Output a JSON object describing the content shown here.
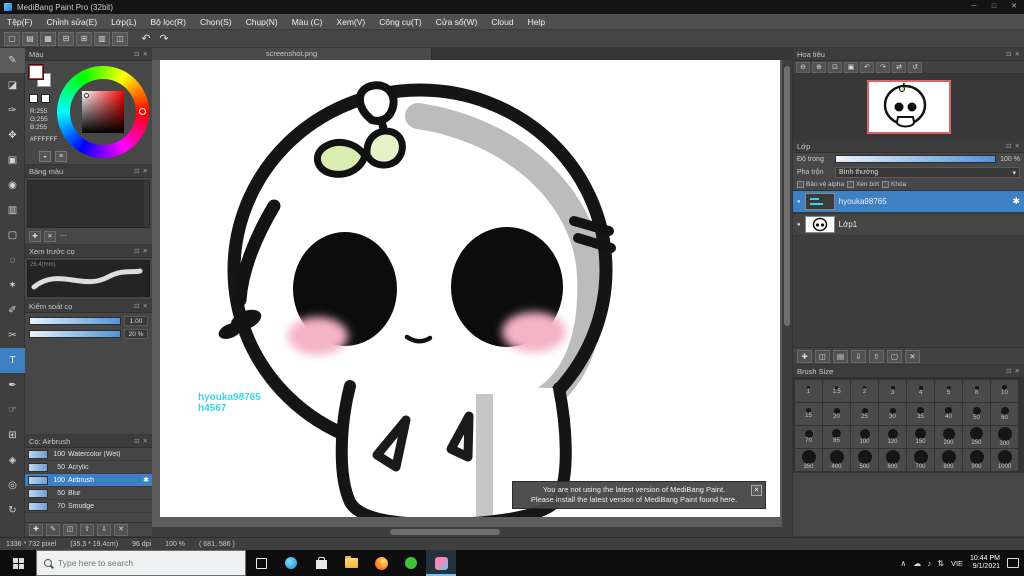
{
  "titlebar": {
    "title": "MediBang Paint Pro (32bit)",
    "minimize": "─",
    "maximize": "□",
    "close": "✕"
  },
  "menubar": [
    "Tệp(F)",
    "Chỉnh sửa(E)",
    "Lớp(L)",
    "Bộ lọc(R)",
    "Chọn(S)",
    "Chụp(N)",
    "Màu (C)",
    "Xem(V)",
    "Công cụ(T)",
    "Cửa sổ(W)",
    "Cloud",
    "Help"
  ],
  "panel": {
    "float_icon": "⊡",
    "close_icon": "✕"
  },
  "toolbar": {
    "buttons": [
      {
        "name": "new-canvas-button",
        "glyph": "▢"
      },
      {
        "name": "open-file-button",
        "glyph": "▤"
      },
      {
        "name": "save-file-button",
        "glyph": "▦"
      },
      {
        "name": "export-button",
        "glyph": "⊟"
      },
      {
        "name": "grid-toggle-button",
        "glyph": "⊞"
      },
      {
        "name": "ruler-toggle-button",
        "glyph": "▥"
      },
      {
        "name": "material-panel-button",
        "glyph": "◫"
      }
    ],
    "undo": "↶",
    "redo": "↷"
  },
  "tools": [
    {
      "name": "brush-tool",
      "glyph": "✎",
      "hover": true
    },
    {
      "name": "eraser-tool",
      "glyph": "◪"
    },
    {
      "name": "pen-tool",
      "glyph": "✑"
    },
    {
      "name": "move-tool",
      "glyph": "✥"
    },
    {
      "name": "fill-tool",
      "glyph": "▣"
    },
    {
      "name": "bucket-tool",
      "glyph": "◉"
    },
    {
      "name": "gradient-tool",
      "glyph": "▥"
    },
    {
      "name": "select-tool",
      "glyph": "▢"
    },
    {
      "name": "lasso-tool",
      "glyph": "◌"
    },
    {
      "name": "magic-wand-tool",
      "glyph": "✶"
    },
    {
      "name": "select-pen-tool",
      "glyph": "✐"
    },
    {
      "name": "select-eraser-tool",
      "glyph": "✂"
    },
    {
      "name": "text-tool",
      "glyph": "T",
      "selected": true
    },
    {
      "name": "eyedropper-tool",
      "glyph": "✒"
    },
    {
      "name": "hand-tool",
      "glyph": "☞"
    },
    {
      "name": "divide-tool",
      "glyph": "⊞"
    },
    {
      "name": "operation-tool",
      "glyph": "◈"
    },
    {
      "name": "snap-tool",
      "glyph": "◎"
    },
    {
      "name": "rotate-canvas-tool",
      "glyph": "↻"
    }
  ],
  "color_panel": {
    "title": "Màu",
    "r": "R:255",
    "g": "G:255",
    "b": "B:255",
    "hex": "#FFFFFF",
    "mode_buttons": [
      {
        "name": "wheel-mode-button",
        "glyph": "◒"
      },
      {
        "name": "slider-mode-button",
        "glyph": "≡"
      }
    ]
  },
  "palette_panel": {
    "title": "Bảng màu",
    "footer_label": "---",
    "buttons": [
      {
        "name": "add-color-button",
        "glyph": "✚"
      },
      {
        "name": "delete-color-button",
        "glyph": "✕"
      }
    ]
  },
  "preview_panel": {
    "title": "Xem trước cọ",
    "size_label": "26.4(mm)"
  },
  "control_panel": {
    "title": "Kiểm soát cọ",
    "rows": [
      {
        "name": "brush-size-slider",
        "value": "1.00"
      },
      {
        "name": "brush-opacity-slider",
        "value": "20 %"
      }
    ]
  },
  "brush_panel": {
    "title": "Cọ: Airbrush",
    "gear": "✱",
    "items": [
      {
        "size": "100",
        "name": "Watercolor (Wet)"
      },
      {
        "size": "50",
        "name": "Acrylic"
      },
      {
        "size": "100",
        "name": "Airbrush",
        "selected": true
      },
      {
        "size": "50",
        "name": "Blur"
      },
      {
        "size": "70",
        "name": "Smudge"
      }
    ],
    "buttons": [
      {
        "name": "add-brush-button",
        "glyph": "✚"
      },
      {
        "name": "edit-brush-button",
        "glyph": "✎"
      },
      {
        "name": "duplicate-brush-button",
        "glyph": "◫"
      },
      {
        "name": "brush-up-button",
        "glyph": "⇧"
      },
      {
        "name": "brush-down-button",
        "glyph": "⇩"
      },
      {
        "name": "delete-brush-button",
        "glyph": "✕"
      }
    ]
  },
  "navigator_panel": {
    "title": "Hoa tiêu",
    "buttons": [
      {
        "name": "zoom-out-button",
        "glyph": "⊖"
      },
      {
        "name": "zoom-in-button",
        "glyph": "⊕"
      },
      {
        "name": "fit-view-button",
        "glyph": "⊡"
      },
      {
        "name": "actual-size-button",
        "glyph": "▣"
      },
      {
        "name": "rotate-left-button",
        "glyph": "↶"
      },
      {
        "name": "rotate-right-button",
        "glyph": "↷"
      },
      {
        "name": "flip-view-button",
        "glyph": "⇄"
      },
      {
        "name": "reset-view-button",
        "glyph": "↺"
      }
    ]
  },
  "layers_panel": {
    "title": "Lớp",
    "opacity_label": "Độ trong",
    "opacity_value": "100 %",
    "blend_label": "Pha trộn",
    "blend_value": "Bình thường",
    "checkboxes": [
      "Bảo vệ alpha",
      "Xén bớt",
      "Khóa"
    ],
    "layers": [
      {
        "name": "hyouka98765"
      },
      {
        "name": "Lớp1"
      }
    ],
    "eye": "●",
    "gear": "✱",
    "dropdown_arrow": "▾",
    "buttons": [
      {
        "name": "new-layer-button",
        "glyph": "✚"
      },
      {
        "name": "duplicate-layer-button",
        "glyph": "◫"
      },
      {
        "name": "layer-folder-button",
        "glyph": "▤"
      },
      {
        "name": "merge-down-button",
        "glyph": "⇩"
      },
      {
        "name": "transfer-button",
        "glyph": "⇧"
      },
      {
        "name": "clear-layer-button",
        "glyph": "▢"
      },
      {
        "name": "delete-layer-button",
        "glyph": "✕"
      }
    ]
  },
  "brush_size_panel": {
    "title": "Brush Size",
    "sizes": [
      "1",
      "1.5",
      "2",
      "3",
      "4",
      "5",
      "8",
      "10",
      "15",
      "20",
      "25",
      "30",
      "35",
      "40",
      "50",
      "60",
      "70",
      "85",
      "100",
      "120",
      "150",
      "200",
      "250",
      "300",
      "350",
      "400",
      "500",
      "600",
      "700",
      "800",
      "900",
      "1000"
    ]
  },
  "canvas": {
    "tab": "screenshot.png",
    "watermark_line1": "hyouka98765",
    "watermark_line2": "h4567",
    "notification_line1": "You are not using the latest version of MediBang Paint.",
    "notification_line2": "Please install the latest version of MediBang Paint found here.",
    "close": "✕"
  },
  "statusbar": {
    "size": "1336 * 732 pixel",
    "dimensions": "(35.3 * 19.4cm)",
    "dpi": "96 dpi",
    "zoom": "100 %",
    "coords": "( 681, 586 )"
  },
  "taskbar": {
    "search_placeholder": "Type here to search",
    "tray_chevron": "∧",
    "tray_icons": [
      {
        "name": "onedrive-icon",
        "glyph": "☁"
      },
      {
        "name": "volume-icon",
        "glyph": "♪"
      },
      {
        "name": "network-icon",
        "glyph": "⇅"
      }
    ],
    "lang": "VIE",
    "time": "10:44 PM",
    "date": "9/1/2021"
  },
  "colors": {
    "accent": "#3e80c4",
    "watermark": "#35d8e8"
  }
}
